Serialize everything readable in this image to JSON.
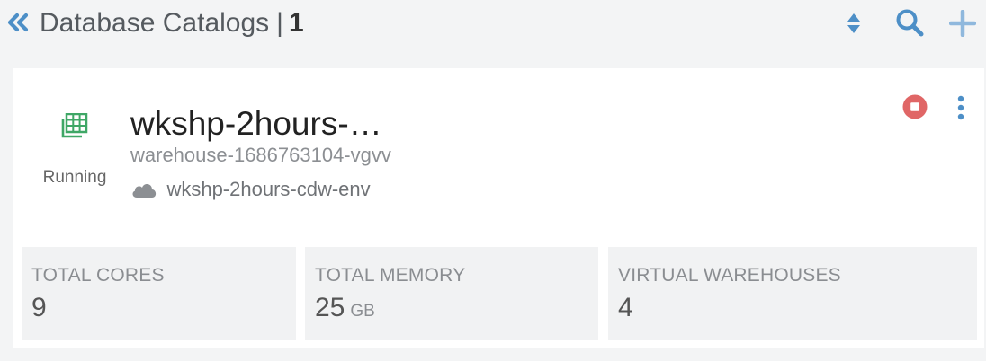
{
  "header": {
    "title": "Database Catalogs",
    "separator": "|",
    "count": "1",
    "icons": {
      "collapse": "double-chevron-left-icon",
      "sort": "sort-icon",
      "search": "search-icon",
      "add": "plus-icon"
    }
  },
  "card": {
    "status": "Running",
    "name": "wkshp-2hours-…",
    "warehouse_id": "warehouse-1686763104-vgvv",
    "environment": "wkshp-2hours-cdw-env",
    "icons": {
      "database": "database-catalog-icon",
      "cloud": "cloud-icon",
      "stop": "stop-icon",
      "menu": "kebab-menu-icon"
    },
    "metrics": [
      {
        "label": "TOTAL CORES",
        "value": "9",
        "unit": ""
      },
      {
        "label": "TOTAL MEMORY",
        "value": "25",
        "unit": "GB"
      },
      {
        "label": "VIRTUAL WAREHOUSES",
        "value": "4",
        "unit": ""
      }
    ]
  },
  "colors": {
    "accent_blue": "#4d8fc7",
    "running_green": "#3fa766",
    "stop_red": "#e06666",
    "background": "#f3f4f5",
    "card": "#ffffff",
    "metric_tile": "#f1f2f3"
  }
}
